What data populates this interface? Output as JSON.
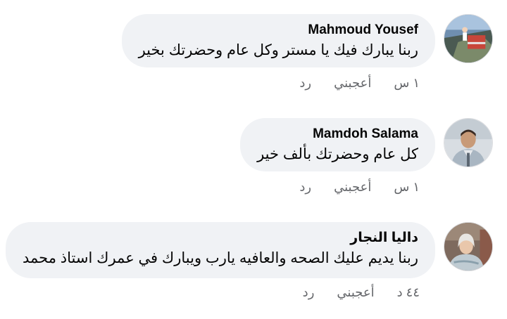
{
  "comments": [
    {
      "author": "Mahmoud Yousef",
      "text": "ربنا يبارك فيك يا مستر وكل عام وحضرتك بخير",
      "time": "١ س",
      "like_label": "أعجبني",
      "reply_label": "رد"
    },
    {
      "author": "Mamdoh Salama",
      "text": "كل عام وحضرتك بألف خير",
      "time": "١ س",
      "like_label": "أعجبني",
      "reply_label": "رد"
    },
    {
      "author": "داليا النجار",
      "text": "ربنا يديم عليك الصحه والعافيه يارب ويبارك في عمرك استاذ محمد",
      "time": "٤٤ د",
      "like_label": "أعجبني",
      "reply_label": "رد"
    }
  ],
  "colors": {
    "bubble_bg": "#f0f2f5",
    "meta_text": "#65676b",
    "primary_text": "#050505"
  }
}
